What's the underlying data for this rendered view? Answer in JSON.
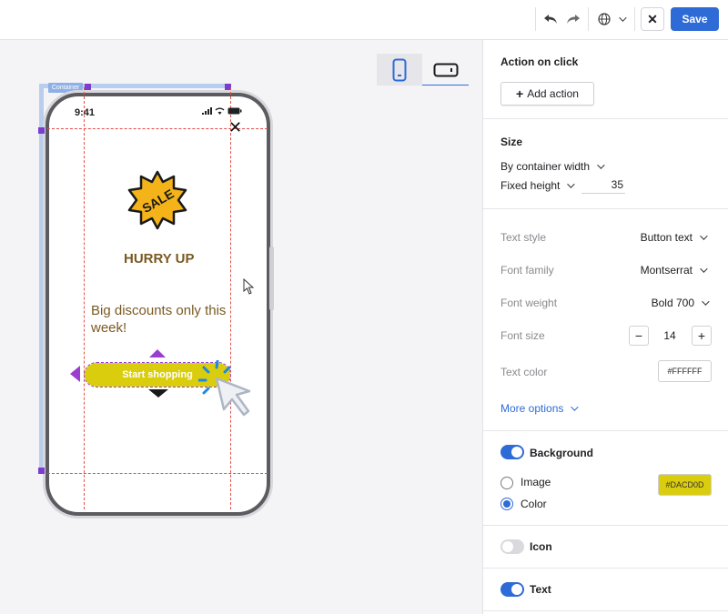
{
  "toolbar": {
    "undo_icon": "undo-icon",
    "redo_icon": "redo-icon",
    "language_icon": "globe-icon",
    "close_label": "✕",
    "save_label": "Save"
  },
  "canvas": {
    "container_tag": "Container",
    "device_modes": [
      "mobile-portrait",
      "mobile-landscape"
    ],
    "active_device": "mobile-portrait",
    "status_time": "9:41",
    "close_symbol": "✕",
    "badge_text": "SALE",
    "headline": "HURRY UP",
    "body_text": "Big discounts only this week!",
    "button_text": "Start shopping",
    "colors": {
      "headline": "#7a5a23",
      "button_bg": "#DACD0D",
      "badge": "#F5B31A",
      "guides": "#e2504c",
      "selection": "#9b3dcf"
    }
  },
  "panel": {
    "action": {
      "title": "Action on click",
      "add_button": "Add action"
    },
    "size": {
      "title": "Size",
      "width_mode": "By container width",
      "height_mode": "Fixed height",
      "height_value": "35"
    },
    "text_style": {
      "style_label": "Text style",
      "style_value": "Button text",
      "family_label": "Font family",
      "family_value": "Montserrat",
      "weight_label": "Font weight",
      "weight_value": "Bold 700",
      "size_label": "Font size",
      "size_value": "14",
      "minus": "−",
      "plus": "+",
      "color_label": "Text color",
      "color_value": "#FFFFFF",
      "more_options": "More options"
    },
    "background": {
      "title": "Background",
      "enabled": true,
      "option_image": "Image",
      "option_color": "Color",
      "selected": "Color",
      "color_value": "#DACD0D"
    },
    "icon": {
      "title": "Icon",
      "enabled": false
    },
    "text": {
      "title": "Text",
      "enabled": true
    },
    "accent_color": "#2f6bd6"
  }
}
